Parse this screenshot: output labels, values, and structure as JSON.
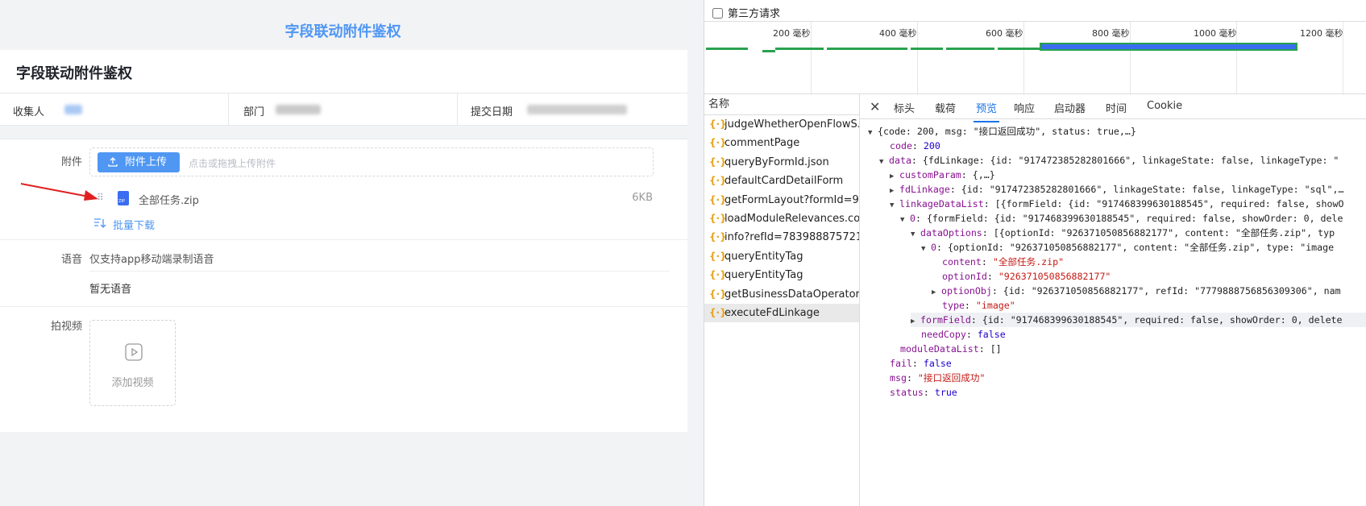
{
  "app": {
    "page_title": "字段联动附件鉴权",
    "form_title": "字段联动附件鉴权",
    "meta": {
      "collector_label": "收集人",
      "dept_label": "部门",
      "date_label": "提交日期"
    },
    "attachment": {
      "label": "附件",
      "upload_button": "附件上传",
      "upload_hint": "点击或拖拽上传附件",
      "file_name": "全部任务.zip",
      "file_size": "6KB",
      "batch_download": "批量下载"
    },
    "voice": {
      "label": "语音",
      "hint": "仅支持app移动端录制语音",
      "empty": "暂无语音"
    },
    "video": {
      "label": "拍视频",
      "add": "添加视频"
    }
  },
  "devtools": {
    "third_party_label": "第三方请求",
    "third_party_checked": false,
    "timeline_ticks": [
      "200 毫秒",
      "400 毫秒",
      "600 毫秒",
      "800 毫秒",
      "1000 毫秒",
      "1200 毫秒"
    ],
    "names_header": "名称",
    "requests": [
      "judgeWhetherOpenFlowS...",
      "commentPage",
      "queryByFormId.json",
      "defaultCardDetailForm",
      "getFormLayout?formId=9...",
      "loadModuleRelevances.co...",
      "info?refId=783988875721...",
      "queryEntityTag",
      "queryEntityTag",
      "getBusinessDataOperator",
      "executeFdLinkage"
    ],
    "selected_request": "executeFdLinkage",
    "tabs": [
      "标头",
      "载荷",
      "预览",
      "响应",
      "启动器",
      "时间",
      "Cookie"
    ],
    "active_tab": "预览",
    "preview": {
      "l0": "{code: 200, msg: \"接口返回成功\", status: true,…}",
      "code_key": "code",
      "code_val": "200",
      "data_key": "data",
      "data_summary": "{fdLinkage: {id: \"917472385282801666\", linkageState: false, linkageType: \"",
      "customParam_key": "customParam",
      "customParam_val": "{,…}",
      "fdLinkage_key": "fdLinkage",
      "fdLinkage_val": "{id: \"917472385282801666\", linkageState: false, linkageType: \"sql\",…",
      "ldl_key": "linkageDataList",
      "ldl_val": "[{formField: {id: \"917468399630188545\", required: false, showO",
      "item0_key": "0",
      "item0_val": "{formField: {id: \"917468399630188545\", required: false, showOrder: 0, dele",
      "dataOptions_key": "dataOptions",
      "dataOptions_val": "[{optionId: \"926371050856882177\", content: \"全部任务.zip\", typ",
      "opt0_key": "0",
      "opt0_val": "{optionId: \"926371050856882177\", content: \"全部任务.zip\", type: \"image",
      "content_key": "content",
      "content_val": "\"全部任务.zip\"",
      "optionId_key": "optionId",
      "optionId_val": "\"926371050856882177\"",
      "optionObj_key": "optionObj",
      "optionObj_val": "{id: \"926371050856882177\", refId: \"7779888756856309306\", nam",
      "type_key": "type",
      "type_val": "\"image\"",
      "formField_key": "formField",
      "formField_val": "{id: \"917468399630188545\", required: false, showOrder: 0, delete",
      "needCopy_key": "needCopy",
      "needCopy_val": "false",
      "mdl_key": "moduleDataList",
      "mdl_val": "[]",
      "fail_key": "fail",
      "fail_val": "false",
      "msg_key": "msg",
      "msg_val": "\"接口返回成功\"",
      "status_key": "status",
      "status_val": "true"
    }
  }
}
